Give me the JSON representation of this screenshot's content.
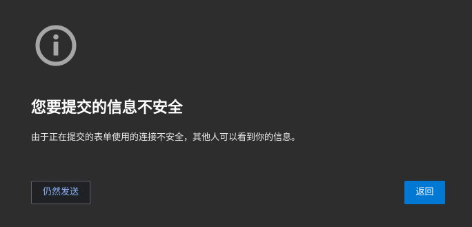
{
  "interstitial": {
    "icon": "info-circle-icon",
    "title": "您要提交的信息不安全",
    "message": "由于正在提交的表单使用的连接不安全，其他人可以看到你的信息。",
    "proceed_label": "仍然发送",
    "back_label": "返回"
  },
  "colors": {
    "background": "#2d2d2d",
    "icon": "#a6a6a6",
    "title": "#ffffff",
    "primary_button": "#0078d4",
    "secondary_button_text": "#8ab4f8"
  }
}
